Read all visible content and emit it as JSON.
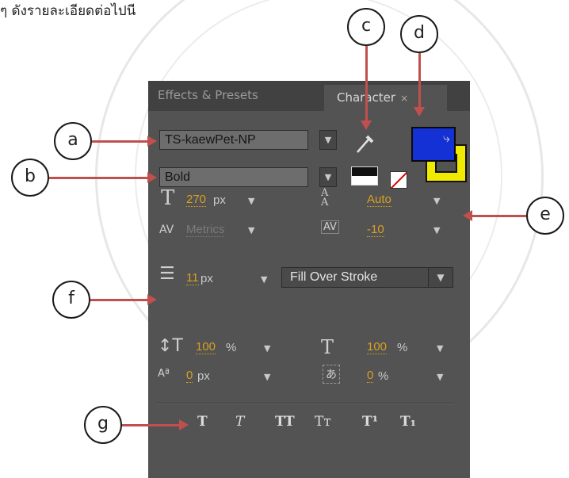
{
  "intro_text": "ๆ ดังรายละเอียดต่อไปนี",
  "panel": {
    "tabs": [
      {
        "label": "Effects & Presets"
      },
      {
        "label": "Character"
      }
    ],
    "close_glyph": "×",
    "menu_glyph": "▾≡",
    "font_family": "TS-kaewPet-NP",
    "font_style": "Bold",
    "font_size": {
      "value": "270",
      "unit": "px"
    },
    "leading": {
      "value": "Auto"
    },
    "kerning": {
      "value": "Metrics"
    },
    "tracking": {
      "value": "-10"
    },
    "stroke_width": {
      "value": "11",
      "unit": "px"
    },
    "stroke_order": "Fill Over Stroke",
    "vertical_scale": {
      "value": "100",
      "unit": "%"
    },
    "horizontal_scale": {
      "value": "100",
      "unit": "%"
    },
    "baseline_shift": {
      "value": "0",
      "unit": "px"
    },
    "tsume": {
      "value": "0",
      "unit": "%"
    },
    "colors": {
      "fill": "#1431d6",
      "stroke": "#f0ea00"
    },
    "type_styles": [
      "T",
      "T",
      "TT",
      "Tт",
      "T¹",
      "T₁"
    ]
  },
  "callouts": {
    "a": "a",
    "b": "b",
    "c": "c",
    "d": "d",
    "e": "e",
    "f": "f",
    "g": "g"
  }
}
